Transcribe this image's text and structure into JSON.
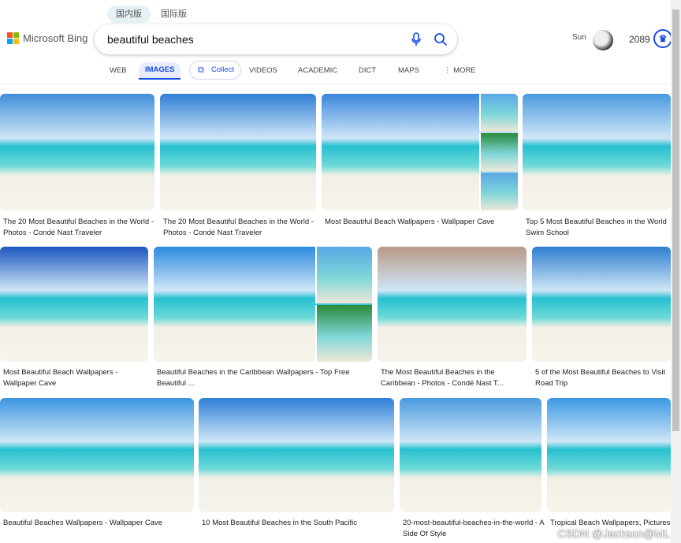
{
  "header": {
    "versions": [
      "国内版",
      "国际版"
    ],
    "active_version": 0,
    "logo_text": "Microsoft Bing",
    "query": "beautiful beaches",
    "user_name": "Sun",
    "points": "2089"
  },
  "tabs": [
    {
      "label": "WEB"
    },
    {
      "label": "IMAGES",
      "active": true
    },
    {
      "label": "Collect"
    },
    {
      "label": "VIDEOS"
    },
    {
      "label": "ACADEMIC"
    },
    {
      "label": "DICT"
    },
    {
      "label": "MAPS"
    },
    {
      "label": "MORE"
    }
  ],
  "results": [
    {
      "caption": "The 20 Most Beautiful Beaches in the World - Photos - Condé Nast Traveler"
    },
    {
      "caption": "The 20 Most Beautiful Beaches in the World - Photos - Condé Nast Traveler"
    },
    {
      "caption": "Most Beautiful Beach Wallpapers - Wallpaper Cave"
    },
    {
      "caption": "Top 5 Most Beautiful Beaches in the World Swim School"
    },
    {
      "caption": "Most Beautiful Beach Wallpapers - Wallpaper Cave"
    },
    {
      "caption": "Beautiful Beaches in the Caribbean Wallpapers - Top Free Beautiful ..."
    },
    {
      "caption": "The Most Beautiful Beaches in the Caribbean - Photos - Condé Nast T..."
    },
    {
      "caption": "5 of the Most Beautiful Beaches to Visit Road Trip"
    },
    {
      "caption": "Beautiful Beaches Wallpapers - Wallpaper Cave"
    },
    {
      "caption": "10 Most Beautiful Beaches in the South Pacific"
    },
    {
      "caption": "20-most-beautiful-beaches-in-the-world - A Side Of Style"
    },
    {
      "caption": "Tropical Beach Wallpapers, Pictures"
    }
  ],
  "watermark": "CSDN @Jackson@ML",
  "colors": {
    "accent": "#174ae4"
  }
}
